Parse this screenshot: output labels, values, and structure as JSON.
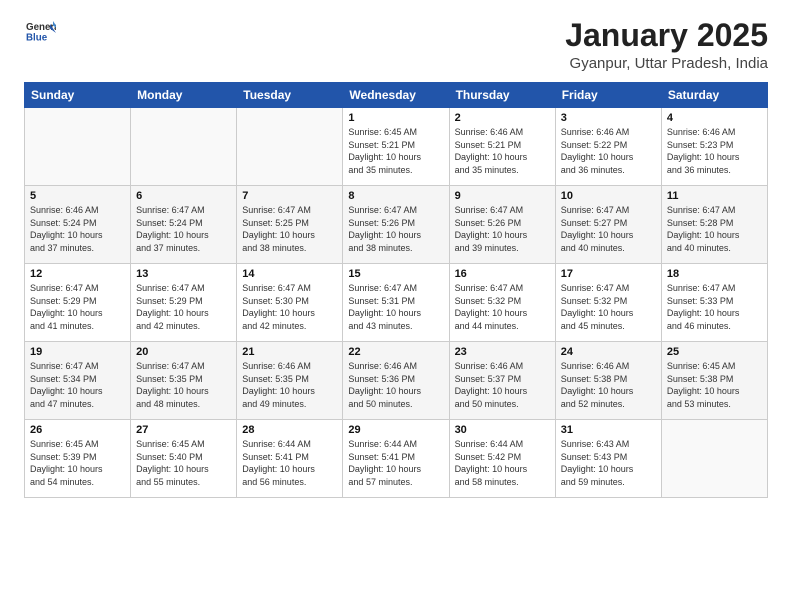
{
  "logo": {
    "general": "General",
    "blue": "Blue"
  },
  "header": {
    "title": "January 2025",
    "subtitle": "Gyanpur, Uttar Pradesh, India"
  },
  "days_of_week": [
    "Sunday",
    "Monday",
    "Tuesday",
    "Wednesday",
    "Thursday",
    "Friday",
    "Saturday"
  ],
  "weeks": [
    [
      {
        "day": "",
        "info": ""
      },
      {
        "day": "",
        "info": ""
      },
      {
        "day": "",
        "info": ""
      },
      {
        "day": "1",
        "info": "Sunrise: 6:45 AM\nSunset: 5:21 PM\nDaylight: 10 hours\nand 35 minutes."
      },
      {
        "day": "2",
        "info": "Sunrise: 6:46 AM\nSunset: 5:21 PM\nDaylight: 10 hours\nand 35 minutes."
      },
      {
        "day": "3",
        "info": "Sunrise: 6:46 AM\nSunset: 5:22 PM\nDaylight: 10 hours\nand 36 minutes."
      },
      {
        "day": "4",
        "info": "Sunrise: 6:46 AM\nSunset: 5:23 PM\nDaylight: 10 hours\nand 36 minutes."
      }
    ],
    [
      {
        "day": "5",
        "info": "Sunrise: 6:46 AM\nSunset: 5:24 PM\nDaylight: 10 hours\nand 37 minutes."
      },
      {
        "day": "6",
        "info": "Sunrise: 6:47 AM\nSunset: 5:24 PM\nDaylight: 10 hours\nand 37 minutes."
      },
      {
        "day": "7",
        "info": "Sunrise: 6:47 AM\nSunset: 5:25 PM\nDaylight: 10 hours\nand 38 minutes."
      },
      {
        "day": "8",
        "info": "Sunrise: 6:47 AM\nSunset: 5:26 PM\nDaylight: 10 hours\nand 38 minutes."
      },
      {
        "day": "9",
        "info": "Sunrise: 6:47 AM\nSunset: 5:26 PM\nDaylight: 10 hours\nand 39 minutes."
      },
      {
        "day": "10",
        "info": "Sunrise: 6:47 AM\nSunset: 5:27 PM\nDaylight: 10 hours\nand 40 minutes."
      },
      {
        "day": "11",
        "info": "Sunrise: 6:47 AM\nSunset: 5:28 PM\nDaylight: 10 hours\nand 40 minutes."
      }
    ],
    [
      {
        "day": "12",
        "info": "Sunrise: 6:47 AM\nSunset: 5:29 PM\nDaylight: 10 hours\nand 41 minutes."
      },
      {
        "day": "13",
        "info": "Sunrise: 6:47 AM\nSunset: 5:29 PM\nDaylight: 10 hours\nand 42 minutes."
      },
      {
        "day": "14",
        "info": "Sunrise: 6:47 AM\nSunset: 5:30 PM\nDaylight: 10 hours\nand 42 minutes."
      },
      {
        "day": "15",
        "info": "Sunrise: 6:47 AM\nSunset: 5:31 PM\nDaylight: 10 hours\nand 43 minutes."
      },
      {
        "day": "16",
        "info": "Sunrise: 6:47 AM\nSunset: 5:32 PM\nDaylight: 10 hours\nand 44 minutes."
      },
      {
        "day": "17",
        "info": "Sunrise: 6:47 AM\nSunset: 5:32 PM\nDaylight: 10 hours\nand 45 minutes."
      },
      {
        "day": "18",
        "info": "Sunrise: 6:47 AM\nSunset: 5:33 PM\nDaylight: 10 hours\nand 46 minutes."
      }
    ],
    [
      {
        "day": "19",
        "info": "Sunrise: 6:47 AM\nSunset: 5:34 PM\nDaylight: 10 hours\nand 47 minutes."
      },
      {
        "day": "20",
        "info": "Sunrise: 6:47 AM\nSunset: 5:35 PM\nDaylight: 10 hours\nand 48 minutes."
      },
      {
        "day": "21",
        "info": "Sunrise: 6:46 AM\nSunset: 5:35 PM\nDaylight: 10 hours\nand 49 minutes."
      },
      {
        "day": "22",
        "info": "Sunrise: 6:46 AM\nSunset: 5:36 PM\nDaylight: 10 hours\nand 50 minutes."
      },
      {
        "day": "23",
        "info": "Sunrise: 6:46 AM\nSunset: 5:37 PM\nDaylight: 10 hours\nand 50 minutes."
      },
      {
        "day": "24",
        "info": "Sunrise: 6:46 AM\nSunset: 5:38 PM\nDaylight: 10 hours\nand 52 minutes."
      },
      {
        "day": "25",
        "info": "Sunrise: 6:45 AM\nSunset: 5:38 PM\nDaylight: 10 hours\nand 53 minutes."
      }
    ],
    [
      {
        "day": "26",
        "info": "Sunrise: 6:45 AM\nSunset: 5:39 PM\nDaylight: 10 hours\nand 54 minutes."
      },
      {
        "day": "27",
        "info": "Sunrise: 6:45 AM\nSunset: 5:40 PM\nDaylight: 10 hours\nand 55 minutes."
      },
      {
        "day": "28",
        "info": "Sunrise: 6:44 AM\nSunset: 5:41 PM\nDaylight: 10 hours\nand 56 minutes."
      },
      {
        "day": "29",
        "info": "Sunrise: 6:44 AM\nSunset: 5:41 PM\nDaylight: 10 hours\nand 57 minutes."
      },
      {
        "day": "30",
        "info": "Sunrise: 6:44 AM\nSunset: 5:42 PM\nDaylight: 10 hours\nand 58 minutes."
      },
      {
        "day": "31",
        "info": "Sunrise: 6:43 AM\nSunset: 5:43 PM\nDaylight: 10 hours\nand 59 minutes."
      },
      {
        "day": "",
        "info": ""
      }
    ]
  ]
}
